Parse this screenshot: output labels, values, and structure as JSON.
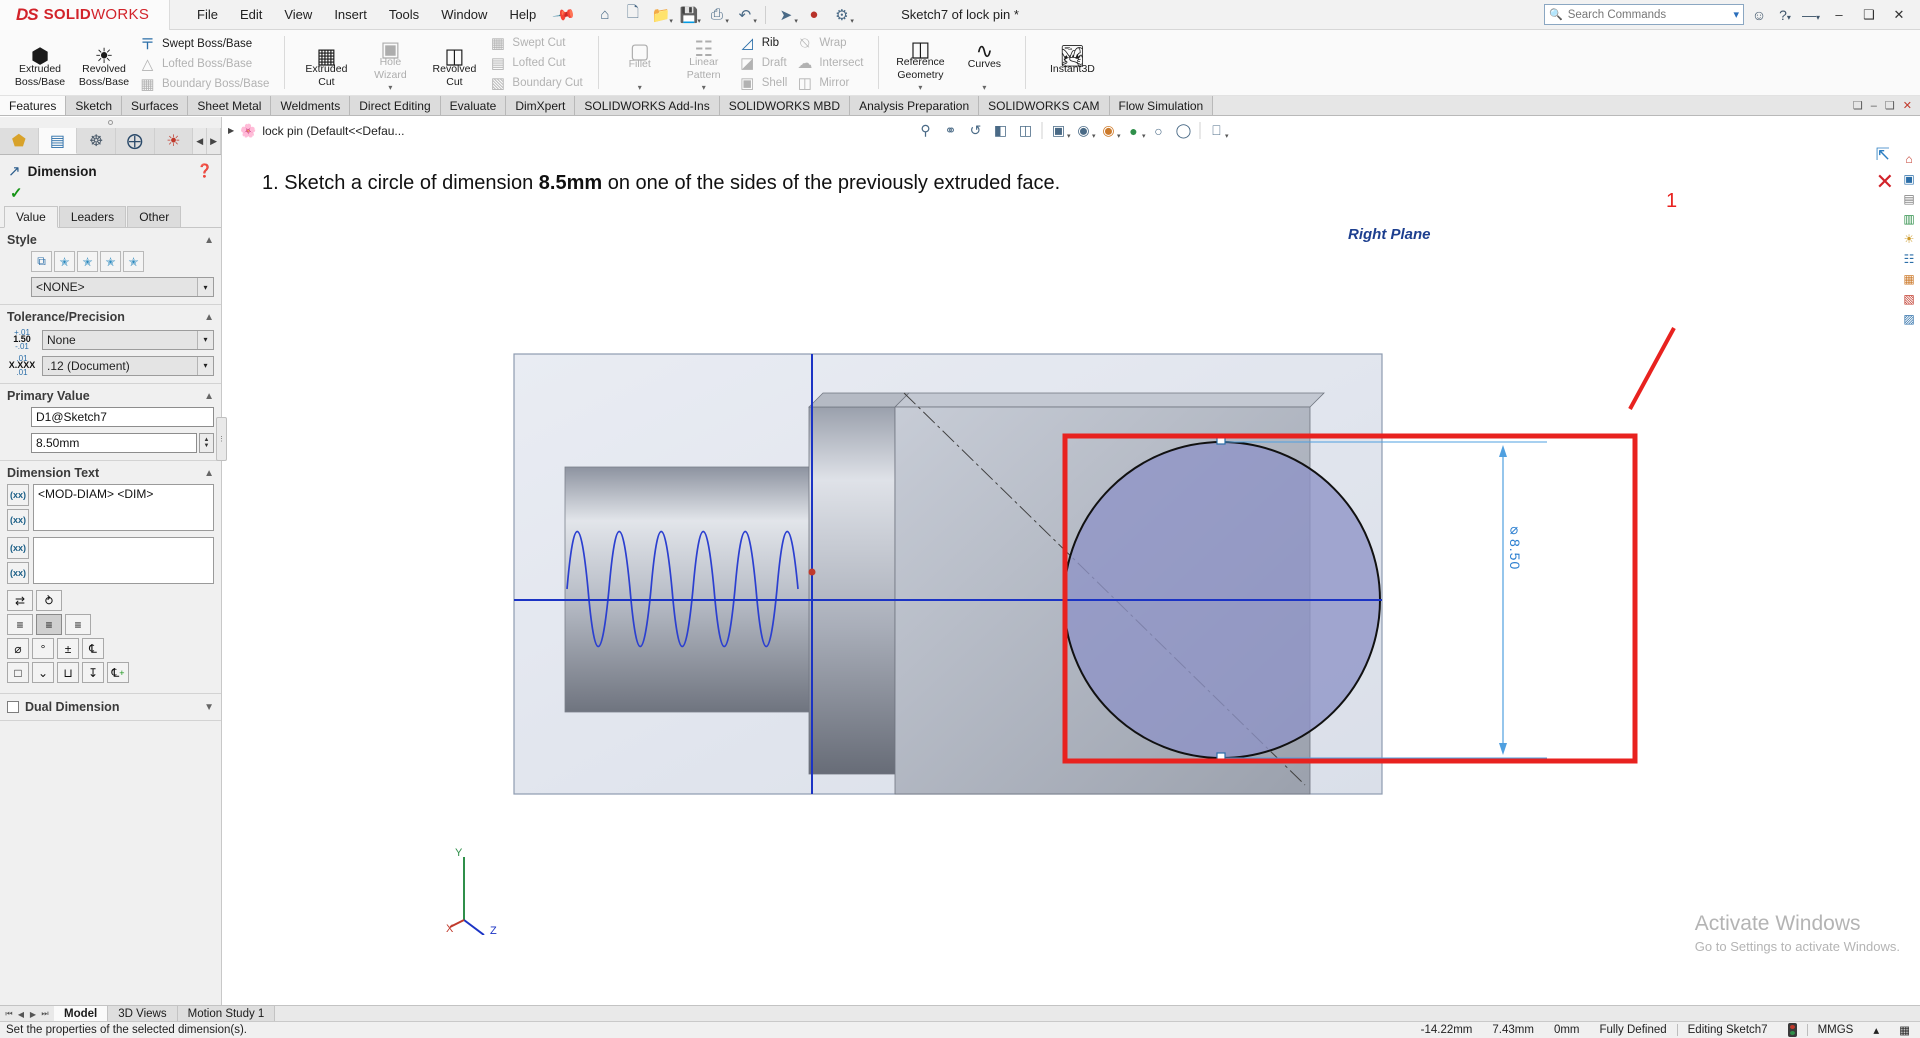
{
  "app": {
    "brand_3ds": "DS",
    "brand_name_bold": "SOLID",
    "brand_name_light": "WORKS",
    "document_title": "Sketch7 of lock pin *",
    "accent_red": "#d2232a",
    "accent_blue": "#2a6ebb"
  },
  "menu": {
    "items": [
      "File",
      "Edit",
      "View",
      "Insert",
      "Tools",
      "Window",
      "Help"
    ],
    "pin_icon": "pushpin-icon"
  },
  "quick_access": [
    {
      "name": "home-icon",
      "glyph": "⌂"
    },
    {
      "name": "new-document-icon",
      "glyph": "❐"
    },
    {
      "name": "open-document-icon",
      "glyph": "Ὄ2"
    },
    {
      "name": "save-icon",
      "glyph": "ὋE"
    },
    {
      "name": "print-icon",
      "glyph": "⎙"
    },
    {
      "name": "undo-icon",
      "glyph": "↶"
    },
    {
      "name": "select-arrow-icon",
      "glyph": "➤"
    },
    {
      "name": "rebuild-icon",
      "glyph": "●"
    },
    {
      "name": "options-icon",
      "glyph": "⚙"
    }
  ],
  "search": {
    "placeholder": "Search Commands",
    "icon": "search-icon",
    "dropdown_icon": "chevron-down-icon"
  },
  "title_right_icons": [
    {
      "name": "user-account-icon",
      "glyph": "○"
    },
    {
      "name": "help-icon",
      "glyph": "?"
    },
    {
      "name": "minimize-button",
      "glyph": "–"
    },
    {
      "name": "restore-button",
      "glyph": "❐"
    },
    {
      "name": "close-button",
      "glyph": "✕"
    }
  ],
  "ribbon": {
    "groups": [
      {
        "name": "boss-base-group",
        "big": [
          {
            "label_line1": "Extruded",
            "label_line2": "Boss/Base",
            "icon": "extruded-boss-icon",
            "disabled": false,
            "caret": false
          },
          {
            "label_line1": "Revolved",
            "label_line2": "Boss/Base",
            "icon": "revolved-boss-icon",
            "disabled": false,
            "caret": false
          }
        ],
        "small": [
          {
            "label": "Swept Boss/Base",
            "icon": "swept-boss-icon",
            "disabled": false
          },
          {
            "label": "Lofted Boss/Base",
            "icon": "lofted-boss-icon",
            "disabled": true
          },
          {
            "label": "Boundary Boss/Base",
            "icon": "boundary-boss-icon",
            "disabled": true
          }
        ]
      },
      {
        "name": "cut-group",
        "big": [
          {
            "label_line1": "Extruded",
            "label_line2": "Cut",
            "icon": "extruded-cut-icon",
            "disabled": false,
            "caret": false
          },
          {
            "label_line1": "Hole",
            "label_line2": "Wizard",
            "icon": "hole-wizard-icon",
            "disabled": true,
            "caret": true
          },
          {
            "label_line1": "Revolved",
            "label_line2": "Cut",
            "icon": "revolved-cut-icon",
            "disabled": false,
            "caret": false
          }
        ],
        "small": [
          {
            "label": "Swept Cut",
            "icon": "swept-cut-icon",
            "disabled": true
          },
          {
            "label": "Lofted Cut",
            "icon": "lofted-cut-icon",
            "disabled": true
          },
          {
            "label": "Boundary Cut",
            "icon": "boundary-cut-icon",
            "disabled": true
          }
        ]
      },
      {
        "name": "features-group",
        "big": [
          {
            "label_line1": "Fillet",
            "label_line2": "",
            "icon": "fillet-icon",
            "disabled": true,
            "caret": true
          },
          {
            "label_line1": "Linear",
            "label_line2": "Pattern",
            "icon": "linear-pattern-icon",
            "disabled": true,
            "caret": true
          }
        ],
        "small": [
          {
            "label": "Rib",
            "icon": "rib-icon",
            "disabled": false
          },
          {
            "label": "Draft",
            "icon": "draft-icon",
            "disabled": true
          },
          {
            "label": "Shell",
            "icon": "shell-icon",
            "disabled": true
          }
        ],
        "small2": [
          {
            "label": "Wrap",
            "icon": "wrap-icon",
            "disabled": true
          },
          {
            "label": "Intersect",
            "icon": "intersect-icon",
            "disabled": true
          },
          {
            "label": "Mirror",
            "icon": "mirror-icon",
            "disabled": true
          }
        ]
      },
      {
        "name": "reference-group",
        "big": [
          {
            "label_line1": "Reference",
            "label_line2": "Geometry",
            "icon": "reference-geometry-icon",
            "disabled": false,
            "caret": true
          },
          {
            "label_line1": "Curves",
            "label_line2": "",
            "icon": "curves-icon",
            "disabled": false,
            "caret": true
          }
        ],
        "small": []
      },
      {
        "name": "instant3d-group",
        "big": [
          {
            "label_line1": "Instant3D",
            "label_line2": "",
            "icon": "instant3d-icon",
            "disabled": false,
            "caret": false
          }
        ],
        "small": []
      }
    ]
  },
  "command_tabs": {
    "items": [
      "Features",
      "Sketch",
      "Surfaces",
      "Sheet Metal",
      "Weldments",
      "Direct Editing",
      "Evaluate",
      "DimXpert",
      "SOLIDWORKS Add-Ins",
      "SOLIDWORKS MBD",
      "Analysis Preparation",
      "SOLIDWORKS CAM",
      "Flow Simulation"
    ],
    "active": "Features",
    "window_icons": [
      {
        "name": "restore-panel-icon",
        "glyph": "❐"
      },
      {
        "name": "minimize-window-icon",
        "glyph": "–"
      },
      {
        "name": "maximize-window-icon",
        "glyph": "❐"
      },
      {
        "name": "close-window-icon",
        "glyph": "✕"
      }
    ]
  },
  "property_manager": {
    "tabs": [
      {
        "name": "feature-manager-tab",
        "icon": "feature-tree-icon",
        "glyph": "⬟",
        "active": false
      },
      {
        "name": "property-manager-tab",
        "icon": "property-list-icon",
        "glyph": "☰",
        "active": true
      },
      {
        "name": "configuration-manager-tab",
        "icon": "configuration-icon",
        "glyph": "⎇",
        "active": false
      },
      {
        "name": "dimxpert-manager-tab",
        "icon": "dimxpert-target-icon",
        "glyph": "⊕",
        "active": false
      },
      {
        "name": "display-manager-tab",
        "icon": "appearance-sphere-icon",
        "glyph": "◕",
        "active": false
      }
    ],
    "header": {
      "icon": "dimension-icon",
      "title": "Dimension",
      "help_icon": "help-icon",
      "ok_icon": "checkmark-icon"
    },
    "value_tabs": {
      "items": [
        "Value",
        "Leaders",
        "Other"
      ],
      "active": "Value"
    },
    "style": {
      "title": "Style",
      "buttons": [
        {
          "name": "apply-default-style-button",
          "glyph": "❐"
        },
        {
          "name": "add-style-button",
          "glyph": "★"
        },
        {
          "name": "delete-style-button",
          "glyph": "★"
        },
        {
          "name": "save-style-button",
          "glyph": "★"
        },
        {
          "name": "load-style-button",
          "glyph": "★"
        }
      ],
      "selected": "<NONE>"
    },
    "tolerance": {
      "title": "Tolerance/Precision",
      "tolerance_value": "None",
      "tolerance_icon_top": "+.01",
      "tolerance_icon_mid": "1.50",
      "tolerance_icon_bot": "-.01",
      "precision_value": ".12 (Document)",
      "precision_icon_top": ".01",
      "precision_icon_mid": "X.XXX",
      "precision_icon_bot": ".01"
    },
    "primary_value": {
      "title": "Primary Value",
      "name_field": "D1@Sketch7",
      "value_field": "8.50mm"
    },
    "dimension_text": {
      "title": "Dimension Text",
      "textarea_1": "<MOD-DIAM> <DIM>",
      "textarea_2": "",
      "btn_top_1": "add-symbol-before-button",
      "btn_bot_1": "add-symbol-after-button",
      "btn_top_2": "add-symbol-before-button-2",
      "btn_bot_2": "add-symbol-after-button-2",
      "symbol_rows": [
        [
          {
            "name": "more-symbols-button",
            "glyph": "↔"
          },
          {
            "name": "dimension-text-style-button",
            "glyph": "⤡"
          }
        ],
        [
          {
            "name": "align-left-button",
            "glyph": "≡",
            "active": false
          },
          {
            "name": "align-center-button",
            "glyph": "≡",
            "active": true
          },
          {
            "name": "align-right-button",
            "glyph": "≡",
            "active": false
          }
        ],
        [
          {
            "name": "diameter-symbol-button",
            "glyph": "⌀"
          },
          {
            "name": "degree-symbol-button",
            "glyph": "°"
          },
          {
            "name": "plus-minus-symbol-button",
            "glyph": "±"
          },
          {
            "name": "centerline-symbol-button",
            "glyph": "℄"
          }
        ],
        [
          {
            "name": "square-symbol-button",
            "glyph": "□"
          },
          {
            "name": "chevron-symbol-button",
            "glyph": "⌄"
          },
          {
            "name": "counterbore-symbol-button",
            "glyph": "⊔"
          },
          {
            "name": "depth-symbol-button",
            "glyph": "↧"
          },
          {
            "name": "add-symbol-plus-button",
            "glyph": "℄"
          }
        ]
      ]
    },
    "dual_dimension": {
      "label": "Dual Dimension",
      "checked": false
    }
  },
  "graphics": {
    "tree_item": "lock pin  (Default<<Defau...",
    "tree_expand_icon": "expand-arrow-icon",
    "tree_part_icon": "part-document-icon",
    "view_tools": [
      {
        "name": "zoom-to-fit-icon",
        "glyph": "⌕"
      },
      {
        "name": "zoom-to-area-icon",
        "glyph": "⌕"
      },
      {
        "name": "previous-view-icon",
        "glyph": "↺"
      },
      {
        "name": "section-view-icon",
        "glyph": "◧"
      },
      {
        "name": "view-orientation-icon",
        "glyph": "❐"
      },
      {
        "name": "display-style-icon",
        "glyph": "▣"
      },
      {
        "name": "hide-show-items-icon",
        "glyph": "◉"
      },
      {
        "name": "edit-appearance-icon",
        "glyph": "◕"
      },
      {
        "name": "apply-scene-icon",
        "glyph": "●"
      },
      {
        "name": "view-settings-icon",
        "glyph": "○"
      },
      {
        "name": "viewport-icon",
        "glyph": "❑"
      },
      {
        "name": "display-pane-icon",
        "glyph": "▭"
      }
    ],
    "instruction_prefix": "1. Sketch a circle of dimension ",
    "instruction_bold": "8.5mm",
    "instruction_suffix": " on one of the sides of the previously extruded face.",
    "plane_label": "Right Plane",
    "callout_number": "1",
    "dimension_text": "⌀8.50",
    "triad_labels": {
      "y": "Y",
      "x": "X",
      "z": "Z"
    },
    "watermark_line1": "Activate Windows",
    "watermark_line2": "Go to Settings to activate Windows.",
    "right_toolbar": [
      {
        "name": "view-home-icon",
        "glyph": "⌂"
      },
      {
        "name": "appearances-icon",
        "glyph": "◔"
      },
      {
        "name": "scenes-icon",
        "glyph": "▤"
      },
      {
        "name": "decals-icon",
        "glyph": "▧"
      },
      {
        "name": "lights-cameras-icon",
        "glyph": "☀"
      },
      {
        "name": "custom-property-icon",
        "glyph": "☷"
      },
      {
        "name": "design-library-icon",
        "glyph": "▥"
      },
      {
        "name": "file-explorer-icon",
        "glyph": "▦"
      },
      {
        "name": "view-palette-icon",
        "glyph": "▨"
      }
    ],
    "confirm_corner": {
      "accept_icon": "accept-sketch-icon",
      "cancel_icon": "cancel-sketch-icon"
    }
  },
  "bottom_tabs": {
    "items": [
      "Model",
      "3D Views",
      "Motion Study 1"
    ],
    "active": "Model",
    "nav_icons": [
      {
        "name": "first-tab-icon",
        "glyph": "⏮"
      },
      {
        "name": "prev-tab-icon",
        "glyph": "◀"
      },
      {
        "name": "next-tab-icon",
        "glyph": "▶"
      },
      {
        "name": "last-tab-icon",
        "glyph": "⏭"
      }
    ]
  },
  "status_bar": {
    "message": "Set the properties of the selected dimension(s).",
    "x_coord": "-14.22mm",
    "y_coord": "7.43mm",
    "z_coord": "0mm",
    "sketch_state": "Fully Defined",
    "editing": "Editing Sketch7",
    "units": "MMGS",
    "units_caret": "▴",
    "traffic_icon": "sketch-status-traffic-icon",
    "overlay_icon": "overlay-icon"
  }
}
